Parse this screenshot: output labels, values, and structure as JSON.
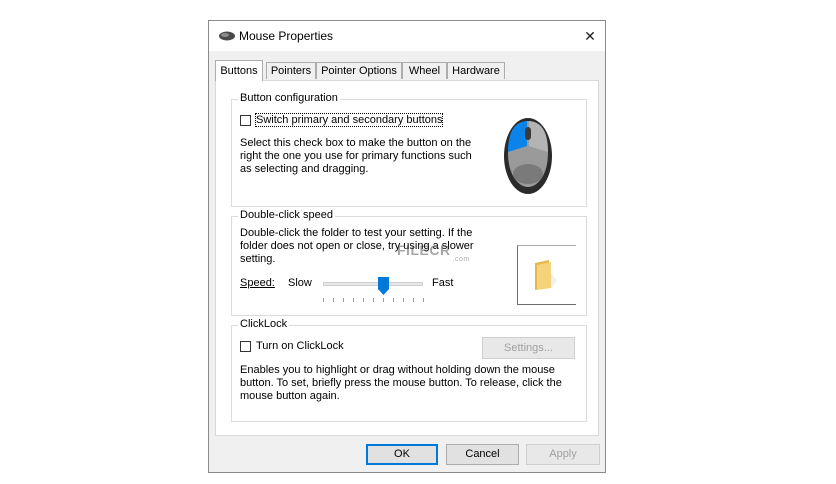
{
  "window": {
    "title": "Mouse Properties",
    "close_glyph": "✕"
  },
  "tabs": [
    {
      "label": "Buttons",
      "active": true
    },
    {
      "label": "Pointers",
      "active": false
    },
    {
      "label": "Pointer Options",
      "active": false
    },
    {
      "label": "Wheel",
      "active": false
    },
    {
      "label": "Hardware",
      "active": false
    }
  ],
  "button_config": {
    "title": "Button configuration",
    "checkbox_label": "Switch primary and secondary buttons",
    "checked": false,
    "description": "Select this check box to make the button on the right the one you use for primary functions such as selecting and dragging."
  },
  "double_click": {
    "title": "Double-click speed",
    "description": "Double-click the folder to test your setting. If the folder does not open or close, try using a slower setting.",
    "speed_label": "Speed:",
    "slow_label": "Slow",
    "fast_label": "Fast",
    "speed_value": 0.6
  },
  "clicklock": {
    "title": "ClickLock",
    "checkbox_label": "Turn on ClickLock",
    "checked": false,
    "settings_button": "Settings...",
    "description": "Enables you to highlight or drag without holding down the mouse button. To set, briefly press the mouse button. To release, click the mouse button again."
  },
  "footer": {
    "ok": "OK",
    "cancel": "Cancel",
    "apply": "Apply"
  },
  "watermark": {
    "text": "FILECR",
    "suffix": ".com"
  },
  "colors": {
    "accent": "#0078d7",
    "folder": "#f5d37a"
  }
}
